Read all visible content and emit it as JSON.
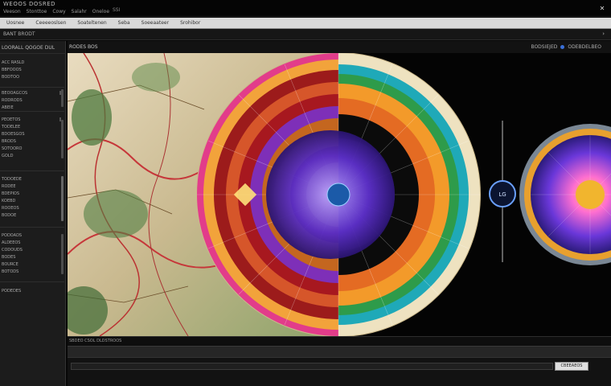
{
  "window": {
    "title": "WEOOS DOSRED",
    "center_text": "SSI",
    "close_glyph": "✕"
  },
  "menu": [
    "Veeson",
    "Stonttoe",
    "Cowy",
    "Salahr",
    "Oneloe"
  ],
  "toolbar": [
    "Uosnee",
    "Ceeeeoslsen",
    "Soateltenen",
    "Seba",
    "Soeeaateer",
    "Srohibor"
  ],
  "strip": {
    "label": "BANT BRODT",
    "arrow": "›"
  },
  "sidebar": {
    "header": "LOORALL QOGOE DUL",
    "groups": [
      {
        "rows": [
          "ACC RASLD",
          "BBFOOOS",
          "BODTOO"
        ]
      },
      {
        "rows": [
          "BEOOAGCOS",
          "RODRODS",
          "ABEIE"
        ]
      },
      {
        "rows": [
          "PEOETOS",
          "TODELEE",
          "BDOESGOS",
          "BRODS",
          "SOTOORO",
          "GOLD"
        ]
      },
      {
        "rows": [
          "TODOEDE",
          "RODEE",
          "BDEPIOS",
          "KOEBD",
          "ROOEOS",
          "BODOE"
        ]
      },
      {
        "rows": [
          "PODOADS",
          "ALDEEOS",
          "CODOUDS",
          "BODES",
          "BOURCE",
          "BOTODS"
        ]
      },
      {
        "rows": [
          "PODEDES"
        ]
      }
    ]
  },
  "panel": {
    "left_label": "RODES BOS",
    "right_label_1": "BODSIEJED",
    "right_label_2": "ODEBDELBEO"
  },
  "canvas": {
    "center_marker": "LG"
  },
  "status": {
    "line": "SBDEO CSOL DLDSTROOS",
    "button": "CBEEAEOS"
  },
  "colors": {
    "accent": "#3a6fd8",
    "toolbar_bg": "#d9d9d9",
    "sidebar_bg": "#1c1c1c",
    "canvas_bg": "#040404"
  }
}
